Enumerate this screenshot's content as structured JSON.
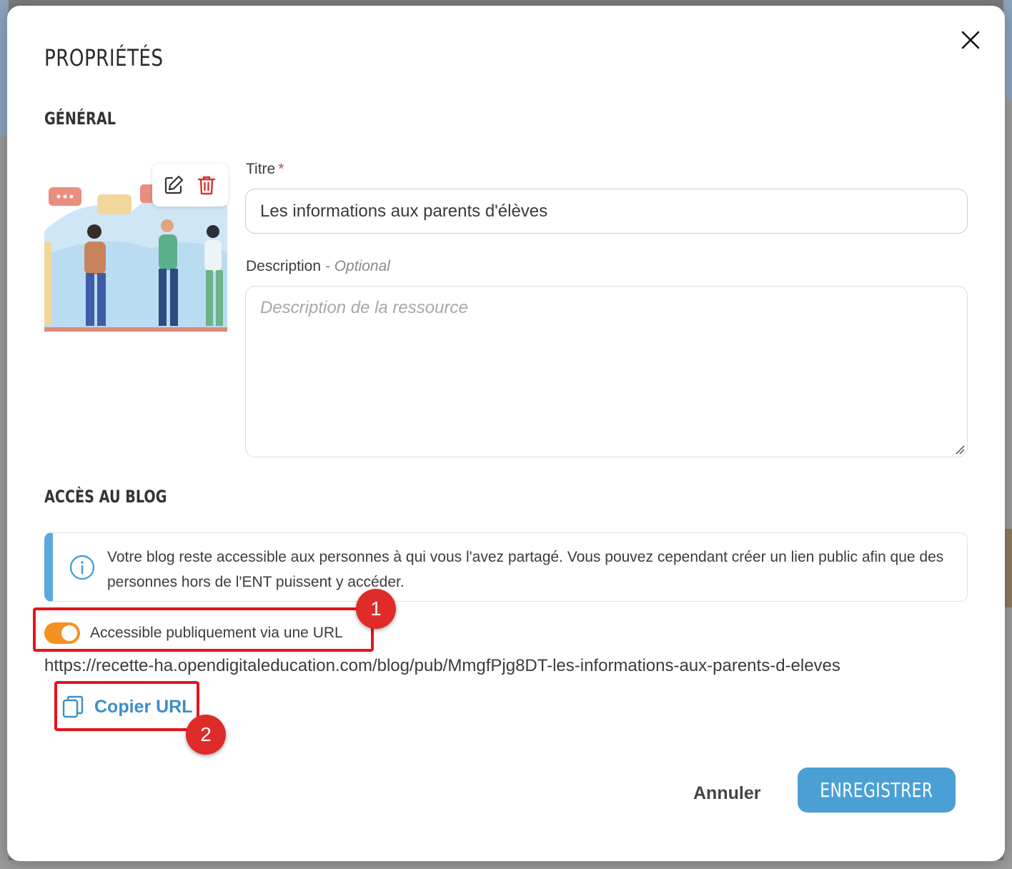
{
  "modal": {
    "title": "PROPRIÉTÉS",
    "close_icon": "close-icon"
  },
  "general": {
    "section_title": "GÉNÉRAL",
    "thumbnail_actions": [
      "edit-icon",
      "trash-icon"
    ],
    "title_label": "Titre",
    "title_required_mark": "*",
    "title_value": "Les informations aux parents d'élèves",
    "description_label": "Description",
    "description_optional": "- Optional",
    "description_placeholder": "Description de la ressource"
  },
  "access": {
    "section_title": "ACCÈS AU BLOG",
    "info_text": "Votre blog reste accessible aux personnes à qui vous l'avez partagé. Vous pouvez cependant créer un lien public afin que des personnes hors de l'ENT puissent y accéder.",
    "toggle_label": "Accessible publiquement via une URL",
    "toggle_on": true,
    "public_url": "https://recette-ha.opendigitaleducation.com/blog/pub/MmgfPjg8DT-les-informations-aux-parents-d-eleves",
    "copy_label": "Copier URL"
  },
  "annotations": {
    "badge_1": "1",
    "badge_2": "2"
  },
  "footer": {
    "cancel_label": "Annuler",
    "save_label": "ENREGISTRER"
  },
  "colors": {
    "accent": "#4aa0d5",
    "toggle": "#f39220",
    "highlight": "#e3151b",
    "info_border": "#5aa9dc",
    "danger_icon": "#d9322e"
  }
}
